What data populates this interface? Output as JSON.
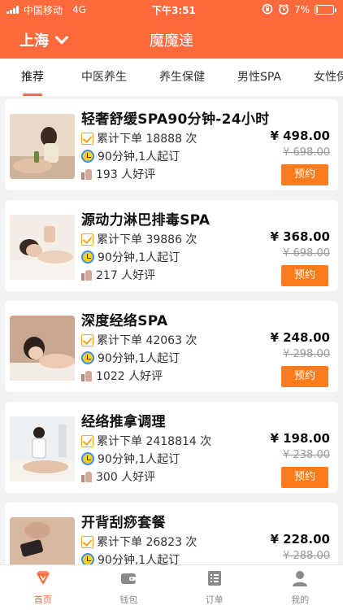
{
  "status_bar": {
    "carrier": "中国移动",
    "network": "4G",
    "time": "下午3:51",
    "battery": "7%"
  },
  "header": {
    "city": "上海",
    "app_title": "魔魔達"
  },
  "tabs": [
    {
      "label": "推荐",
      "active": true
    },
    {
      "label": "中医养生",
      "active": false
    },
    {
      "label": "养生保健",
      "active": false
    },
    {
      "label": "男性SPA",
      "active": false
    },
    {
      "label": "女性保健",
      "active": false
    }
  ],
  "services": [
    {
      "title": "轻奢舒缓SPA90分钟-24小时",
      "orders": "累计下单 18888 次",
      "duration": "90分钟,1人起订",
      "reviews": "193 人好评",
      "price": "¥ 498.00",
      "old_price": "¥ 698.00",
      "book_label": "预约"
    },
    {
      "title": "源动力淋巴排毒SPA",
      "orders": "累计下单 39886 次",
      "duration": "90分钟,1人起订",
      "reviews": "217 人好评",
      "price": "¥ 368.00",
      "old_price": "¥ 698.00",
      "book_label": "预约"
    },
    {
      "title": "深度经络SPA",
      "orders": "累计下单 42063 次",
      "duration": "90分钟,1人起订",
      "reviews": "1022 人好评",
      "price": "¥ 248.00",
      "old_price": "¥ 298.00",
      "book_label": "预约"
    },
    {
      "title": "经络推拿调理",
      "orders": "累计下单 2418814 次",
      "duration": "90分钟,1人起订",
      "reviews": "300 人好评",
      "price": "¥ 198.00",
      "old_price": "¥ 238.00",
      "book_label": "预约"
    },
    {
      "title": "开背刮痧套餐",
      "orders": "累计下单 26823 次",
      "duration": "90分钟,1人起订",
      "reviews": "",
      "price": "¥ 228.00",
      "old_price": "¥ 288.00",
      "book_label": ""
    }
  ],
  "bottom_nav": [
    {
      "label": "首页",
      "icon": "home-icon",
      "active": true
    },
    {
      "label": "钱包",
      "icon": "wallet-icon",
      "active": false
    },
    {
      "label": "订单",
      "icon": "order-list-icon",
      "active": false
    },
    {
      "label": "我的",
      "icon": "user-icon",
      "active": false
    }
  ],
  "colors": {
    "brand": "#ff6a3d",
    "book_button": "#ff7b1a"
  }
}
